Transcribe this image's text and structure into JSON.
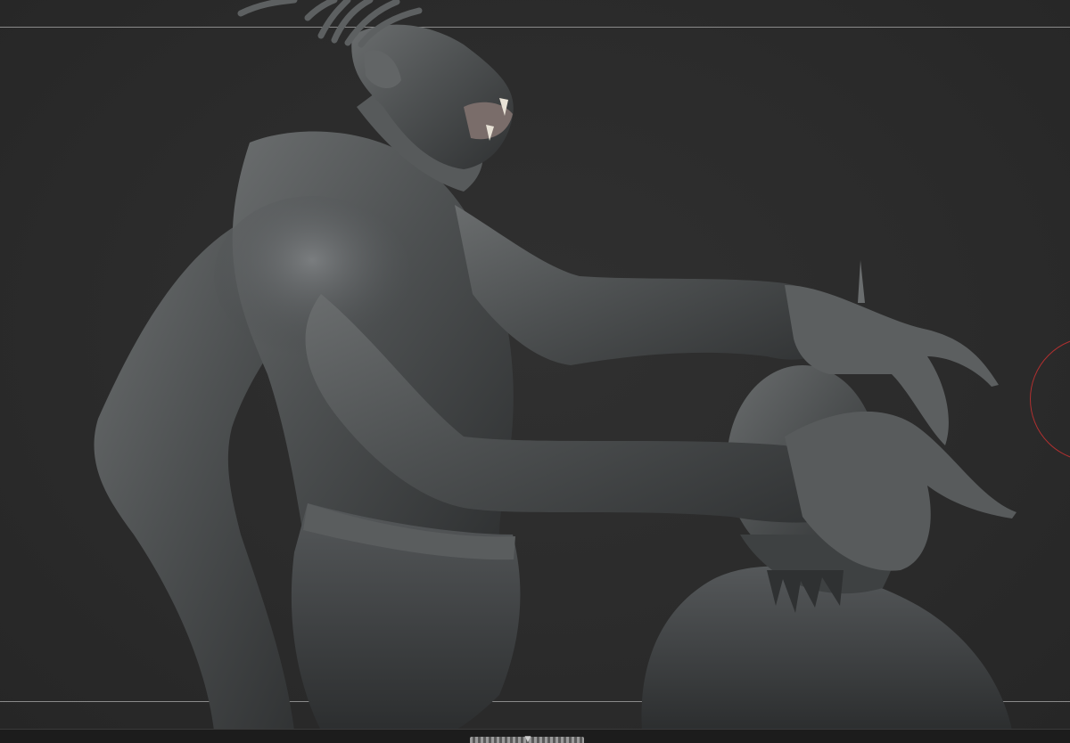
{
  "viewport": {
    "background": "#2b2b2b",
    "frame_line_color": "#8a8a8a",
    "gizmo_color": "#b03030",
    "model_color": "#4f5253"
  },
  "bottom_bar": {
    "handle_icon": "scroll-handle-icon"
  }
}
